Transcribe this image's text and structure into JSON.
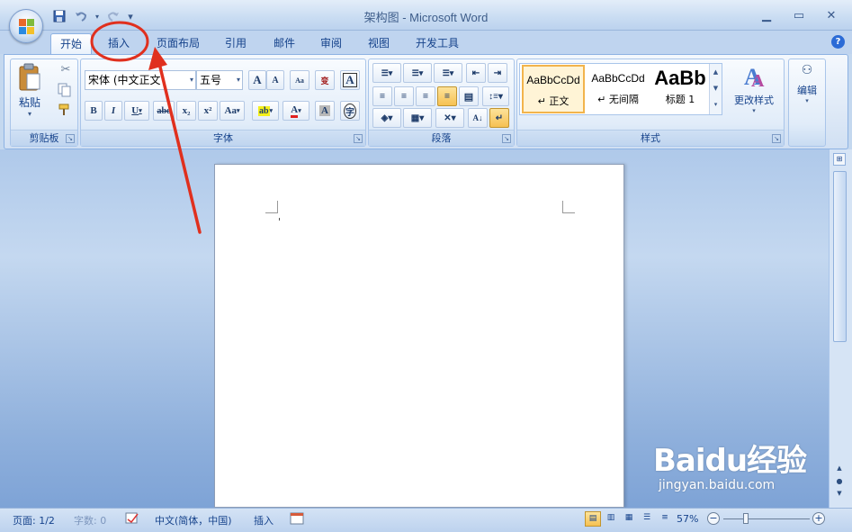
{
  "window": {
    "title": "架构图 - Microsoft Word"
  },
  "qat": {
    "save": "save-icon",
    "undo": "undo-icon",
    "redo": "redo-icon",
    "more": "▾"
  },
  "controls": {
    "minimize": "▁",
    "maximize": "▭",
    "close": "✕"
  },
  "tabs": [
    "开始",
    "插入",
    "页面布局",
    "引用",
    "邮件",
    "审阅",
    "视图",
    "开发工具"
  ],
  "active_tab": "开始",
  "help": "?",
  "ribbon": {
    "clipboard": {
      "label": "剪贴板",
      "paste": "粘贴"
    },
    "font": {
      "label": "字体",
      "font_name": "宋体 (中文正文",
      "font_size": "五号",
      "grow": "A",
      "shrink": "A",
      "bold": "B",
      "italic": "I",
      "underline": "U",
      "strike": "abe",
      "sub": "x₂",
      "sup": "x²",
      "case": "Aa",
      "highlight": "ab",
      "color": "A",
      "shade": "A",
      "enclose": "字",
      "phonetic": "wén",
      "change": "变"
    },
    "paragraph": {
      "label": "段落"
    },
    "styles": {
      "label": "样式",
      "items": [
        {
          "sample": "AaBbCcDd",
          "name": "↵ 正文"
        },
        {
          "sample": "AaBbCcDd",
          "name": "↵ 无间隔"
        },
        {
          "sample": "AaBb",
          "name": "标题 1"
        }
      ],
      "change_styles": "更改样式"
    },
    "editing": {
      "label": "编辑",
      "icon": "binoculars-icon"
    }
  },
  "statusbar": {
    "page": "页面: 1/2",
    "words": "字数: 0",
    "lang": "中文(简体，中国)",
    "mode": "插入",
    "zoom": "57%"
  },
  "watermark": {
    "main": "Baidu经验",
    "sub": "jingyan.baidu.com"
  },
  "colors": {
    "annotation": "#e0301e",
    "accent": "#15428b"
  }
}
